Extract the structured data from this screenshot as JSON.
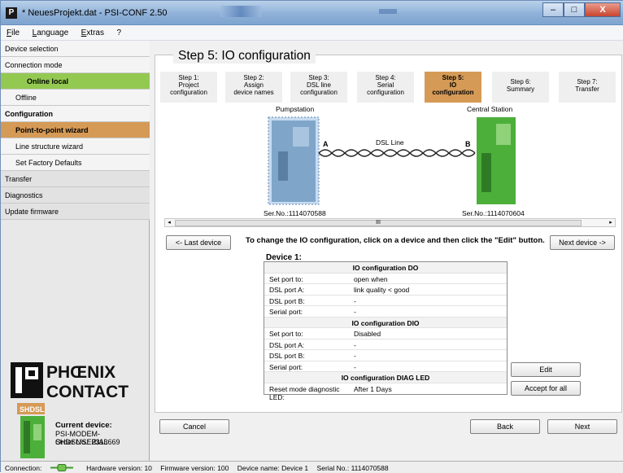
{
  "window": {
    "title": "* NeuesProjekt.dat - PSI-CONF 2.50",
    "buttons": {
      "minimize": "–",
      "maximize": "□",
      "close": "X"
    }
  },
  "menu": [
    "File",
    "Language",
    "Extras",
    "?"
  ],
  "sidebar": {
    "items": [
      {
        "label": "Device selection",
        "style": "normal"
      },
      {
        "label": "Connection mode",
        "style": "normal"
      },
      {
        "label": "Online local",
        "style": "green"
      },
      {
        "label": "Offline",
        "style": "indent"
      },
      {
        "label": "Configuration",
        "style": "bold"
      },
      {
        "label": "Point-to-point wizard",
        "style": "orange"
      },
      {
        "label": "Line structure wizard",
        "style": "indent"
      },
      {
        "label": "Set Factory Defaults",
        "style": "indent"
      },
      {
        "label": "Transfer",
        "style": "grey"
      },
      {
        "label": "Diagnostics",
        "style": "grey"
      },
      {
        "label": "Update firmware",
        "style": "grey"
      }
    ],
    "logo_text": "PHOENIX CONTACT",
    "current_device": {
      "label": "Current device:",
      "name": "PSI-MODEM-SHDSL/SERIAL",
      "order": "Order No.:  2313669",
      "badge": "SHDSL"
    }
  },
  "main": {
    "step_title": "Step 5: IO configuration",
    "steps": [
      {
        "label": "Step 1:\nProject\nconfiguration",
        "active": false
      },
      {
        "label": "Step 2:\nAssign\ndevice names",
        "active": false
      },
      {
        "label": "Step 3:\nDSL line\nconfiguration",
        "active": false
      },
      {
        "label": "Step 4:\nSerial\nconfiguration",
        "active": false
      },
      {
        "label": "Step 5:\nIO\nconfiguration",
        "active": true
      },
      {
        "label": "Step 6:\nSummary",
        "active": false
      },
      {
        "label": "Step 7:\nTransfer",
        "active": false
      }
    ],
    "diagram": {
      "left_device": "Pumpstation",
      "right_device": "Central Station",
      "line_label": "DSL Line",
      "port_a": "A",
      "port_b": "B",
      "left_serial": "Ser.No.:1114070588",
      "right_serial": "Ser.No.:1114070604"
    },
    "scroll_marker": "III",
    "last_device_btn": "<- Last device",
    "next_device_btn": "Next device ->",
    "instruction": "To change the IO configuration, click on a device and then click the \"Edit\" button.",
    "device_label": "Device 1:",
    "table": [
      {
        "type": "header",
        "text": "IO configuration DO"
      },
      {
        "type": "row",
        "key": "Set port to:",
        "value": "open when"
      },
      {
        "type": "row",
        "key": "DSL port A:",
        "value": "link quality < good"
      },
      {
        "type": "row",
        "key": "DSL port B:",
        "value": "-"
      },
      {
        "type": "row",
        "key": "Serial port:",
        "value": "-"
      },
      {
        "type": "header",
        "text": "IO configuration DIO"
      },
      {
        "type": "row",
        "key": "Set port to:",
        "value": "Disabled"
      },
      {
        "type": "row",
        "key": "DSL port A:",
        "value": "-"
      },
      {
        "type": "row",
        "key": "DSL port B:",
        "value": "-"
      },
      {
        "type": "row",
        "key": "Serial port:",
        "value": "-"
      },
      {
        "type": "header",
        "text": "IO configuration DIAG LED"
      },
      {
        "type": "row",
        "key": "Reset mode diagnostic LED:",
        "value": "After 1 Days"
      }
    ],
    "edit_btn": "Edit",
    "accept_btn": "Accept for all",
    "cancel_btn": "Cancel",
    "back_btn": "Back",
    "next_btn": "Next"
  },
  "status": {
    "connection": "Connection:",
    "hardware": "Hardware version:  10",
    "firmware": "Firmware version:  100",
    "device_name": "Device name:  Device 1",
    "serial": "Serial No.:  1114070588"
  },
  "colors": {
    "green": "#93c951",
    "orange": "#d59a56",
    "device_blue": "#7fa6c9",
    "device_green": "#4caf3a"
  }
}
